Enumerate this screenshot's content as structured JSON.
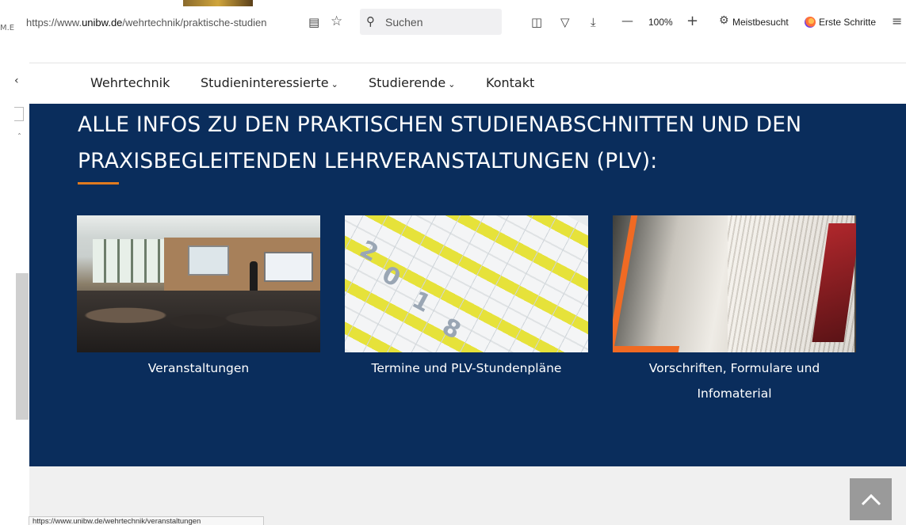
{
  "browser": {
    "left_fragment": "M.E",
    "url_prefix": "https://www.",
    "url_domain": "unibw.de",
    "url_path": "/wehrtechnik/praktische-studien",
    "search_placeholder": "Suchen",
    "zoom_label": "100%",
    "bookmark_1": "Meistbesucht",
    "bookmark_2": "Erste Schritte",
    "status_url": "https://www.unibw.de/wehrtechnik/veranstaltungen"
  },
  "nav": {
    "items": [
      {
        "label": "Wehrtechnik",
        "dropdown": false
      },
      {
        "label": "Studieninteressierte",
        "dropdown": true
      },
      {
        "label": "Studierende",
        "dropdown": true
      },
      {
        "label": "Kontakt",
        "dropdown": false
      }
    ]
  },
  "hero": {
    "title_line1": "ALLE INFOS ZU DEN PRAKTISCHEN STUDIENABSCHNITTEN UND DEN",
    "title_line2": "PRAXISBEGLEITENDEN LEHRVERANSTALTUNGEN (PLV):",
    "accent_color": "#e07a1f",
    "background_color": "#0a2d5c",
    "cards": [
      {
        "caption": "Veranstaltungen",
        "image": "lecture-room-photo"
      },
      {
        "caption": "Termine und PLV-Stundenpläne",
        "image": "calendar-2018-photo"
      },
      {
        "caption": "Vorschriften, Formulare und Infomaterial",
        "image": "binders-photo"
      }
    ]
  },
  "icons": {
    "reader": "reader-view-icon",
    "star": "bookmark-star-icon",
    "search": "search-icon",
    "library": "library-icon",
    "pocket": "pocket-icon",
    "download": "download-icon",
    "zoom_out": "zoom-out-icon",
    "zoom_in": "zoom-in-icon",
    "gear": "gear-icon",
    "menu": "hamburger-menu-icon",
    "to_top": "chevron-up-icon"
  }
}
